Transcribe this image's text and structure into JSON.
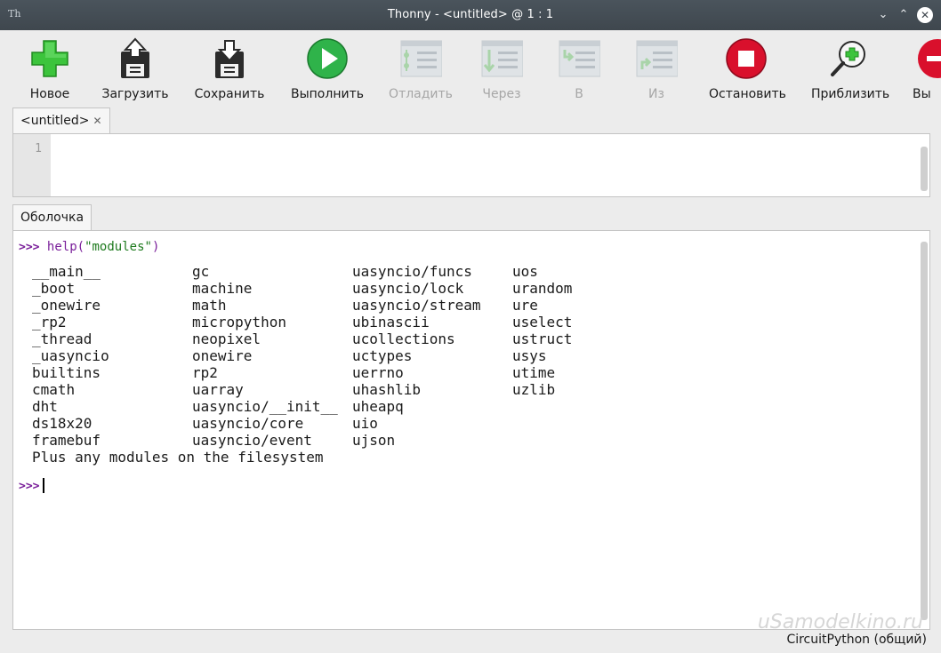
{
  "window": {
    "title": "Thonny - <untitled> @ 1 : 1",
    "app_icon": "Th"
  },
  "toolbar": {
    "items": [
      {
        "label": "Новое",
        "icon": "new-file-icon",
        "enabled": true
      },
      {
        "label": "Загрузить",
        "icon": "load-floppy-icon",
        "enabled": true
      },
      {
        "label": "Сохранить",
        "icon": "save-floppy-icon",
        "enabled": true
      },
      {
        "label": "Выполнить",
        "icon": "run-icon",
        "enabled": true
      },
      {
        "label": "Отладить",
        "icon": "debug-icon",
        "enabled": false
      },
      {
        "label": "Через",
        "icon": "step-over-icon",
        "enabled": false
      },
      {
        "label": "В",
        "icon": "step-into-icon",
        "enabled": false
      },
      {
        "label": "Из",
        "icon": "step-out-icon",
        "enabled": false
      },
      {
        "label": "Остановить",
        "icon": "stop-icon",
        "enabled": true
      },
      {
        "label": "Приблизить",
        "icon": "zoom-in-icon",
        "enabled": true
      },
      {
        "label": "Вы",
        "icon": "zoom-out-icon",
        "enabled": true
      }
    ]
  },
  "editor": {
    "tab_label": "<untitled>",
    "close_glyph": "✕",
    "line_number": "1"
  },
  "shell": {
    "tab_label": "Оболочка",
    "prompt": ">>>",
    "command_fn": "help(",
    "command_str": "\"modules\"",
    "command_close": ")",
    "modules": [
      [
        "__main__",
        "gc",
        "uasyncio/funcs",
        "uos"
      ],
      [
        "_boot",
        "machine",
        "uasyncio/lock",
        "urandom"
      ],
      [
        "_onewire",
        "math",
        "uasyncio/stream",
        "ure"
      ],
      [
        "_rp2",
        "micropython",
        "ubinascii",
        "uselect"
      ],
      [
        "_thread",
        "neopixel",
        "ucollections",
        "ustruct"
      ],
      [
        "_uasyncio",
        "onewire",
        "uctypes",
        "usys"
      ],
      [
        "builtins",
        "rp2",
        "uerrno",
        "utime"
      ],
      [
        "cmath",
        "uarray",
        "uhashlib",
        "uzlib"
      ],
      [
        "dht",
        "uasyncio/__init__",
        "uheapq",
        ""
      ],
      [
        "ds18x20",
        "uasyncio/core",
        "uio",
        ""
      ],
      [
        "framebuf",
        "uasyncio/event",
        "ujson",
        ""
      ]
    ],
    "footer": "Plus any modules on the filesystem"
  },
  "status": {
    "interpreter": "CircuitPython (общий)"
  },
  "watermark": "uSamodelkino.ru",
  "colors": {
    "titlebar": "#434b52",
    "new_green": "#3cc43c",
    "run_green": "#2fb34a",
    "stop_red": "#d9102c",
    "prompt_purple": "#7a1f9a",
    "string_green": "#1e7a1e"
  }
}
